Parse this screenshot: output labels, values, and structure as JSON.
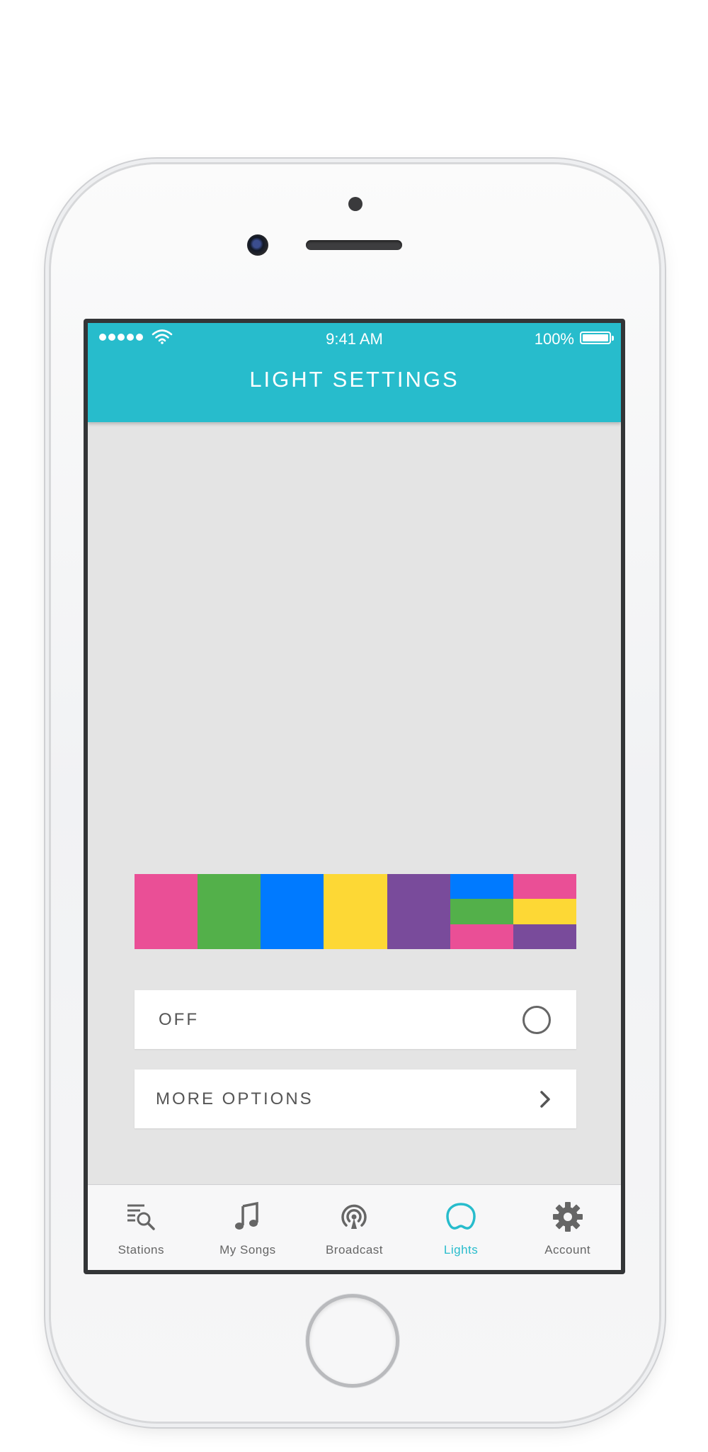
{
  "status_bar": {
    "time": "9:41 AM",
    "battery": "100%"
  },
  "header": {
    "title": "LIGHT SETTINGS"
  },
  "color_palette": {
    "swatches": [
      "#ea4f96",
      "#53b04a",
      "#007aff",
      "#fdd835",
      "#794b9b"
    ],
    "combo_1": [
      "#007aff",
      "#53b04a",
      "#ea4f96"
    ],
    "combo_2": [
      "#ea4f96",
      "#fdd835",
      "#794b9b"
    ]
  },
  "options": {
    "off_label": "OFF",
    "more_label": "MORE OPTIONS"
  },
  "tabs": [
    {
      "label": "Stations",
      "icon": "stations-search-icon",
      "active": false
    },
    {
      "label": "My Songs",
      "icon": "music-note-icon",
      "active": false
    },
    {
      "label": "Broadcast",
      "icon": "broadcast-icon",
      "active": false
    },
    {
      "label": "Lights",
      "icon": "lights-bubble-icon",
      "active": true
    },
    {
      "label": "Account",
      "icon": "gear-icon",
      "active": false
    }
  ],
  "colors": {
    "accent": "#27bccc",
    "background": "#e4e4e4"
  }
}
